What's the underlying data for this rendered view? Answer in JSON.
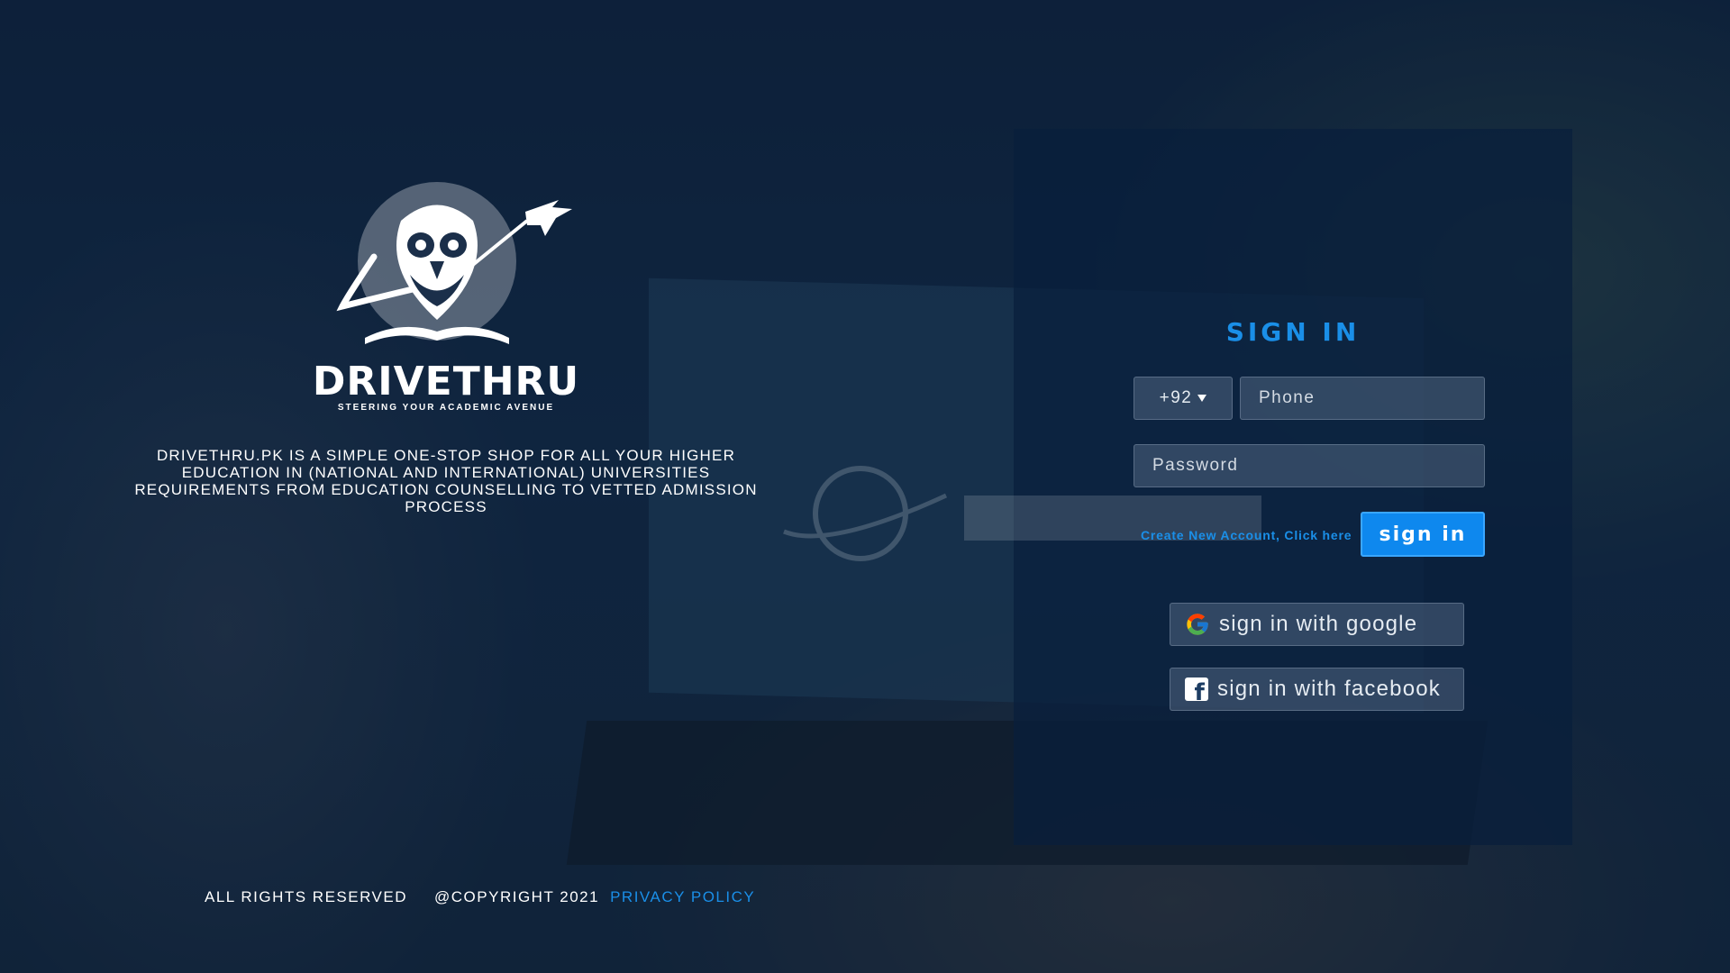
{
  "brand": {
    "name": "DRIVETHRU",
    "tagline": "STEERING YOUR ACADEMIC AVENUE",
    "description": "DRIVETHRU.PK IS A SIMPLE ONE-STOP SHOP FOR ALL YOUR HIGHER EDUCATION IN (NATIONAL AND INTERNATIONAL) UNIVERSITIES REQUIREMENTS FROM EDUCATION COUNSELLING TO VETTED ADMISSION PROCESS"
  },
  "signin": {
    "title": "SIGN IN",
    "country_code": "+92",
    "phone_placeholder": "Phone",
    "password_placeholder": "Password",
    "create_account_link": "Create New Account, Click here",
    "submit_label": "sign in",
    "google_label": "sign in with google",
    "facebook_label": "sign in with facebook"
  },
  "footer": {
    "rights": "ALL RIGHTS RESERVED",
    "copyright": "@COPYRIGHT 2021",
    "privacy": "PRIVACY POLICY"
  },
  "colors": {
    "accent": "#1a8fe8",
    "button": "#0e88ee",
    "panel": "#081e3c"
  },
  "icons": {
    "logo": "owl-globe-airplane-logo",
    "dropdown": "caret-down-icon",
    "google": "google-icon",
    "facebook": "facebook-icon"
  }
}
